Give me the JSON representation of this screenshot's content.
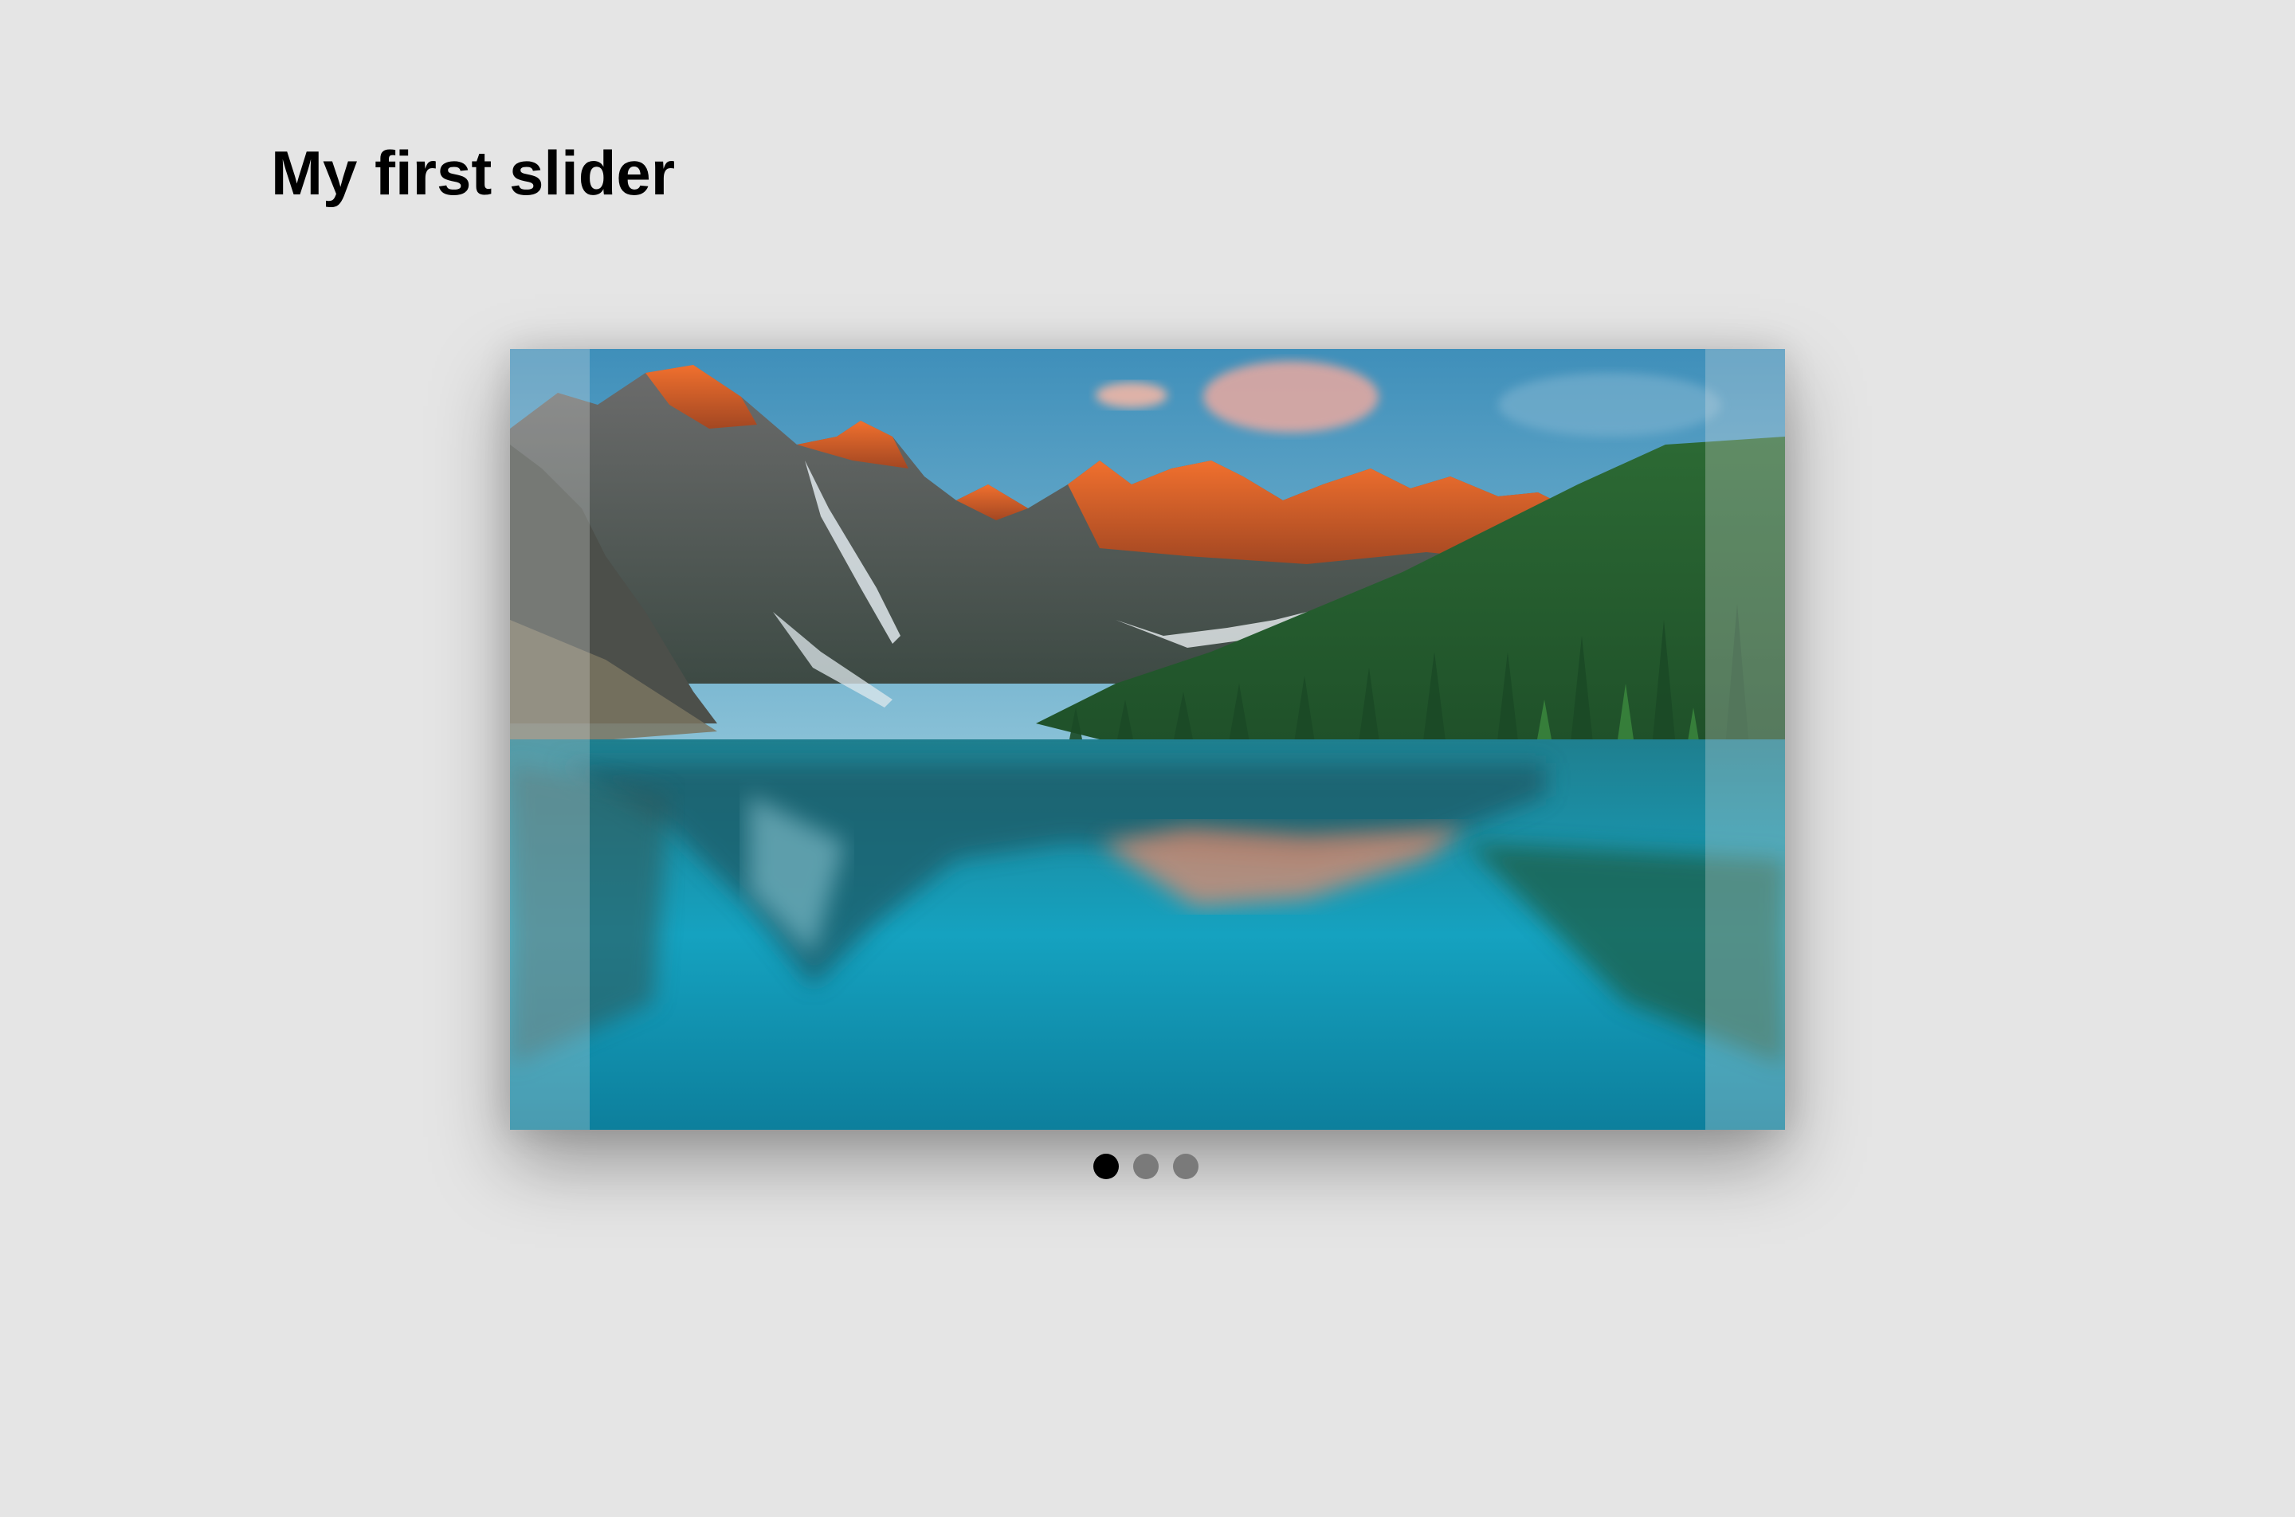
{
  "page": {
    "title": "My first slider"
  },
  "slider": {
    "current_slide": 1,
    "slide_count": 3,
    "slide_image": "mountain-lake-landscape",
    "colors": {
      "sky": "#5aa6c7",
      "peaks": "#e0622e",
      "forest": "#1f5c2c",
      "water": "#1a95ad",
      "dot_active": "#000000",
      "dot_inactive": "#7a7a7a"
    }
  }
}
